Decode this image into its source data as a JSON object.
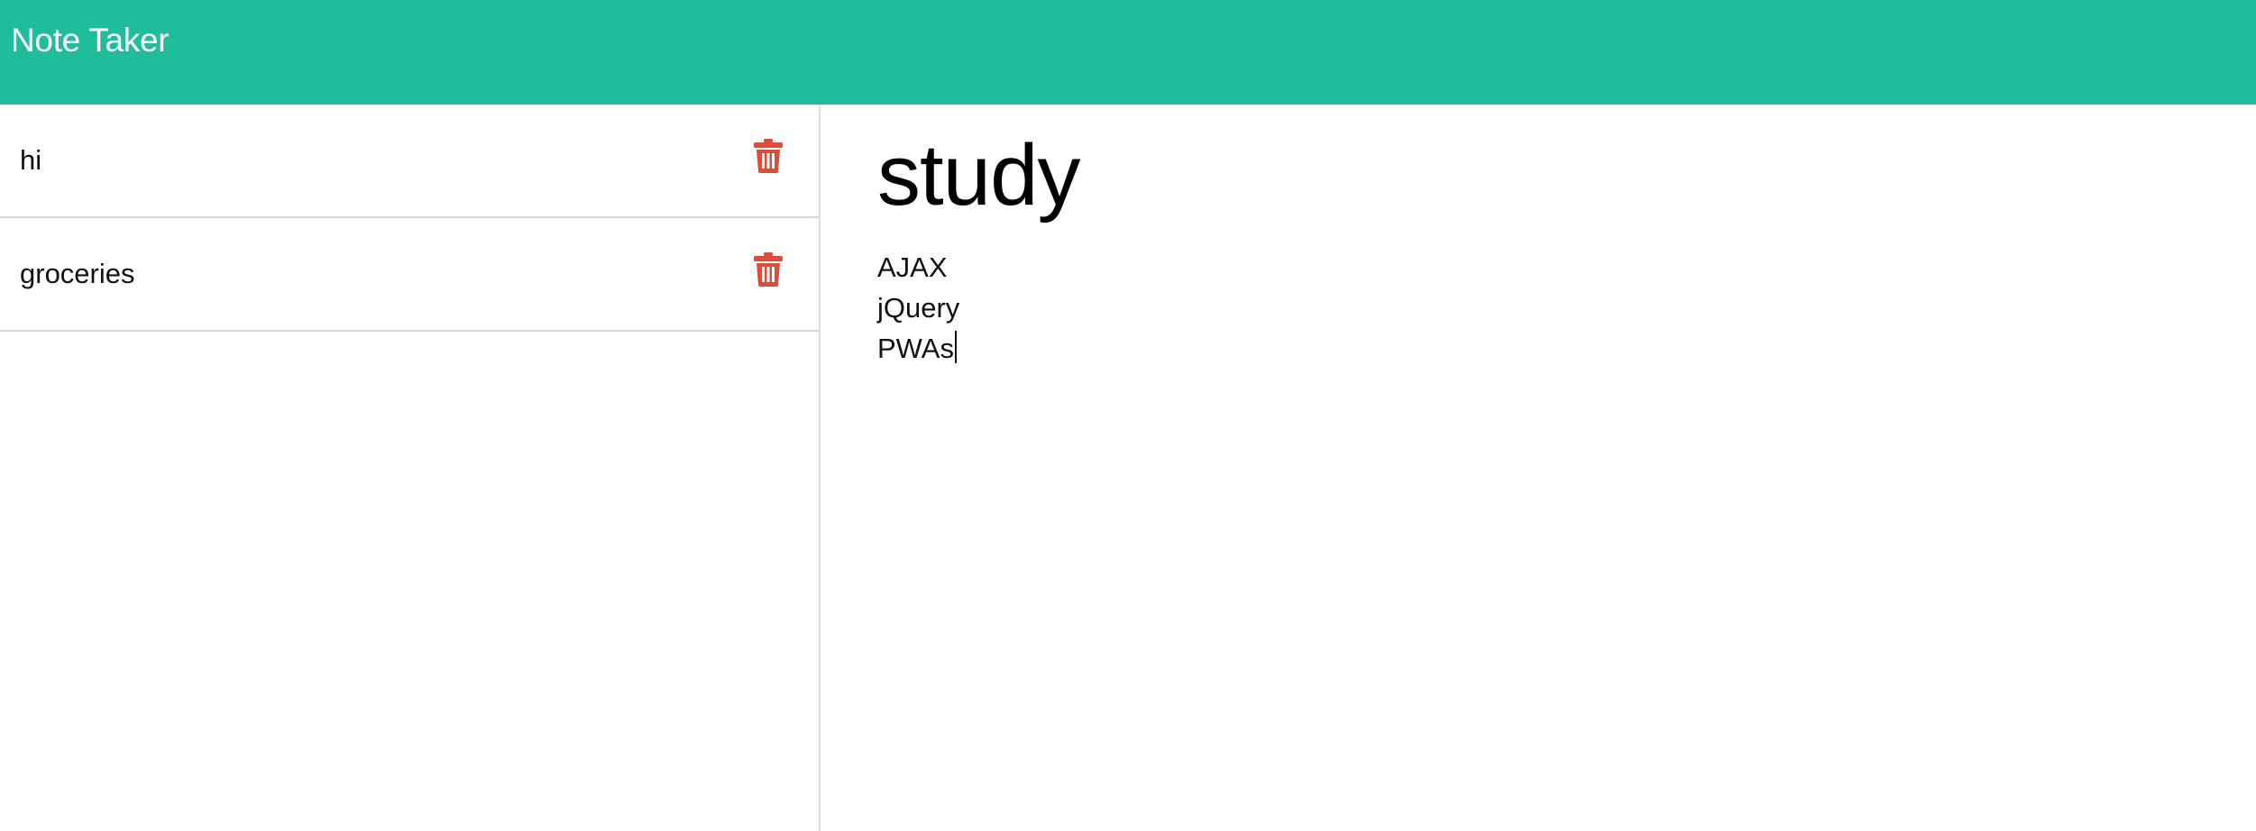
{
  "app": {
    "brand": "Note Taker"
  },
  "notes": [
    {
      "title": "hi"
    },
    {
      "title": "groceries"
    }
  ],
  "active_note": {
    "title": "study",
    "body_lines": [
      "AJAX",
      "jQuery",
      "PWAs"
    ]
  },
  "icons": {
    "delete": "trash-icon"
  },
  "colors": {
    "navbar": "#20bd9c",
    "delete_icon": "#dd4b39",
    "text": "#111111"
  }
}
